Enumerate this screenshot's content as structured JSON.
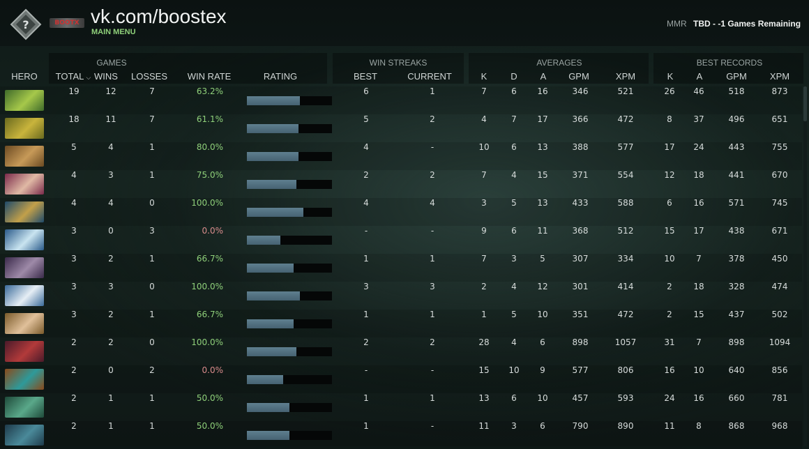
{
  "header": {
    "title": "vk.com/boostex",
    "main_menu": "MAIN MENU",
    "brand_mark": "BOOTX",
    "mmr_label": "MMR",
    "mmr_value": "TBD - -1 Games Remaining"
  },
  "groups": {
    "games": "GAMES",
    "win_streaks": "WIN STREAKS",
    "averages": "AVERAGES",
    "best_records": "BEST RECORDS"
  },
  "columns": {
    "hero": "HERO",
    "total": "TOTAL",
    "wins": "WINS",
    "losses": "LOSSES",
    "win_rate": "WIN RATE",
    "rating": "RATING",
    "best": "BEST",
    "current": "CURRENT",
    "avg_k": "K",
    "avg_d": "D",
    "avg_a": "A",
    "avg_gpm": "GPM",
    "avg_xpm": "XPM",
    "best_k": "K",
    "best_a": "A",
    "best_gpm": "GPM",
    "best_xpm": "XPM"
  },
  "colors": {
    "win_rate_positive": "#8fd07a",
    "win_rate_zero": "#d98c8c",
    "rating_fill": "#5f7f8f"
  },
  "rows": [
    {
      "hero_colors": [
        "#3f6b2a",
        "#a6c84a"
      ],
      "total": "19",
      "wins": "12",
      "losses": "7",
      "win_rate": "63.2%",
      "rating": 0.62,
      "best": "6",
      "current": "1",
      "k": "7",
      "d": "6",
      "a": "16",
      "gpm": "346",
      "xpm": "521",
      "bk": "26",
      "ba": "46",
      "bgpm": "518",
      "bxpm": "873"
    },
    {
      "hero_colors": [
        "#6a6a1e",
        "#c9b43c"
      ],
      "total": "18",
      "wins": "11",
      "losses": "7",
      "win_rate": "61.1%",
      "rating": 0.61,
      "best": "5",
      "current": "2",
      "k": "4",
      "d": "7",
      "a": "17",
      "gpm": "366",
      "xpm": "472",
      "bk": "8",
      "ba": "37",
      "bgpm": "496",
      "bxpm": "651"
    },
    {
      "hero_colors": [
        "#6b4a22",
        "#c79a58"
      ],
      "total": "5",
      "wins": "4",
      "losses": "1",
      "win_rate": "80.0%",
      "rating": 0.61,
      "best": "4",
      "current": "-",
      "k": "10",
      "d": "6",
      "a": "13",
      "gpm": "388",
      "xpm": "577",
      "bk": "17",
      "ba": "24",
      "bgpm": "443",
      "bxpm": "755"
    },
    {
      "hero_colors": [
        "#7a2a4a",
        "#e0b9a5"
      ],
      "total": "4",
      "wins": "3",
      "losses": "1",
      "win_rate": "75.0%",
      "rating": 0.58,
      "best": "2",
      "current": "2",
      "k": "7",
      "d": "4",
      "a": "15",
      "gpm": "371",
      "xpm": "554",
      "bk": "12",
      "ba": "18",
      "bgpm": "441",
      "bxpm": "670"
    },
    {
      "hero_colors": [
        "#1e4a6a",
        "#c2a04a"
      ],
      "total": "4",
      "wins": "4",
      "losses": "0",
      "win_rate": "100.0%",
      "rating": 0.66,
      "best": "4",
      "current": "4",
      "k": "3",
      "d": "5",
      "a": "13",
      "gpm": "433",
      "xpm": "588",
      "bk": "6",
      "ba": "16",
      "bgpm": "571",
      "bxpm": "745"
    },
    {
      "hero_colors": [
        "#2a5a8a",
        "#c9e4f0"
      ],
      "total": "3",
      "wins": "0",
      "losses": "3",
      "win_rate": "0.0%",
      "rating": 0.39,
      "best": "-",
      "current": "-",
      "k": "9",
      "d": "6",
      "a": "11",
      "gpm": "368",
      "xpm": "512",
      "bk": "15",
      "ba": "17",
      "bgpm": "438",
      "bxpm": "671"
    },
    {
      "hero_colors": [
        "#3a2a4a",
        "#9e8aa8"
      ],
      "total": "3",
      "wins": "2",
      "losses": "1",
      "win_rate": "66.7%",
      "rating": 0.55,
      "best": "1",
      "current": "1",
      "k": "7",
      "d": "3",
      "a": "5",
      "gpm": "307",
      "xpm": "334",
      "bk": "10",
      "ba": "7",
      "bgpm": "378",
      "bxpm": "450"
    },
    {
      "hero_colors": [
        "#3a6a9a",
        "#e6eef5"
      ],
      "total": "3",
      "wins": "3",
      "losses": "0",
      "win_rate": "100.0%",
      "rating": 0.62,
      "best": "3",
      "current": "3",
      "k": "2",
      "d": "4",
      "a": "12",
      "gpm": "301",
      "xpm": "414",
      "bk": "2",
      "ba": "18",
      "bgpm": "328",
      "bxpm": "474"
    },
    {
      "hero_colors": [
        "#7a5a2a",
        "#e0c09a"
      ],
      "total": "3",
      "wins": "2",
      "losses": "1",
      "win_rate": "66.7%",
      "rating": 0.55,
      "best": "1",
      "current": "1",
      "k": "1",
      "d": "5",
      "a": "10",
      "gpm": "351",
      "xpm": "472",
      "bk": "2",
      "ba": "15",
      "bgpm": "437",
      "bxpm": "502"
    },
    {
      "hero_colors": [
        "#4a1a2a",
        "#b23a3a"
      ],
      "total": "2",
      "wins": "2",
      "losses": "0",
      "win_rate": "100.0%",
      "rating": 0.58,
      "best": "2",
      "current": "2",
      "k": "28",
      "d": "4",
      "a": "6",
      "gpm": "898",
      "xpm": "1057",
      "bk": "31",
      "ba": "7",
      "bgpm": "898",
      "bxpm": "1094"
    },
    {
      "hero_colors": [
        "#8a4a1a",
        "#2e9a9a"
      ],
      "total": "2",
      "wins": "0",
      "losses": "2",
      "win_rate": "0.0%",
      "rating": 0.43,
      "best": "-",
      "current": "-",
      "k": "15",
      "d": "10",
      "a": "9",
      "gpm": "577",
      "xpm": "806",
      "bk": "16",
      "ba": "10",
      "bgpm": "640",
      "bxpm": "856"
    },
    {
      "hero_colors": [
        "#1e4a3a",
        "#5aa88a"
      ],
      "total": "2",
      "wins": "1",
      "losses": "1",
      "win_rate": "50.0%",
      "rating": 0.5,
      "best": "1",
      "current": "1",
      "k": "13",
      "d": "6",
      "a": "10",
      "gpm": "457",
      "xpm": "593",
      "bk": "24",
      "ba": "16",
      "bgpm": "660",
      "bxpm": "781"
    },
    {
      "hero_colors": [
        "#1e3a4a",
        "#4a8a9a"
      ],
      "total": "2",
      "wins": "1",
      "losses": "1",
      "win_rate": "50.0%",
      "rating": 0.5,
      "best": "1",
      "current": "-",
      "k": "11",
      "d": "3",
      "a": "6",
      "gpm": "790",
      "xpm": "890",
      "bk": "11",
      "ba": "8",
      "bgpm": "868",
      "bxpm": "968"
    }
  ]
}
